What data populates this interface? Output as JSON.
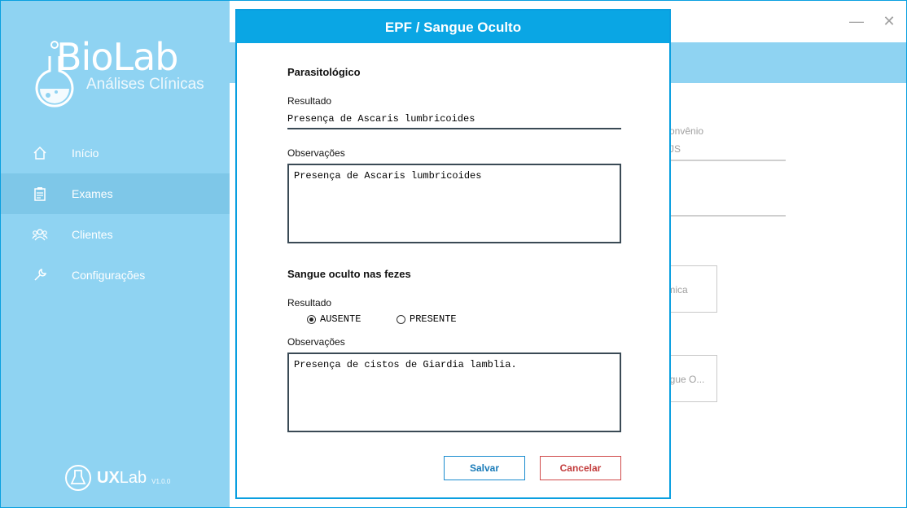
{
  "brand": {
    "logo_title": "BioLab",
    "logo_subtitle": "Análises Clínicas",
    "footer_name_bold": "UX",
    "footer_name_light": "Lab",
    "footer_version": "V1.0.0"
  },
  "sidebar": {
    "items": [
      {
        "label": "Início",
        "icon": "home-icon",
        "active": false
      },
      {
        "label": "Exames",
        "icon": "clipboard-icon",
        "active": true
      },
      {
        "label": "Clientes",
        "icon": "users-icon",
        "active": false
      },
      {
        "label": "Configurações",
        "icon": "wrench-icon",
        "active": false
      }
    ]
  },
  "window": {
    "minimize_glyph": "—",
    "close_glyph": "✕"
  },
  "background": {
    "field_label": "onvênio",
    "field_value": "JS",
    "card1": "ímica",
    "card2": "ngue O..."
  },
  "dialog": {
    "title": "EPF / Sangue Oculto",
    "parasitologico": {
      "section_title": "Parasitológico",
      "resultado_label": "Resultado",
      "resultado_value": "Presença de Ascaris lumbricoides",
      "observacoes_label": "Observações",
      "observacoes_value": "Presença de Ascaris lumbricoides"
    },
    "sangue_oculto": {
      "section_title": "Sangue oculto nas fezes",
      "resultado_label": "Resultado",
      "options": [
        {
          "label": "AUSENTE",
          "selected": true
        },
        {
          "label": "PRESENTE",
          "selected": false
        }
      ],
      "observacoes_label": "Observações",
      "observacoes_value": "Presença de cistos de Giardia lamblia."
    },
    "save_label": "Salvar",
    "cancel_label": "Cancelar"
  },
  "colors": {
    "sidebar_bg": "#8fd3f2",
    "accent": "#0aa6e4",
    "cancel": "#c23b3b"
  }
}
